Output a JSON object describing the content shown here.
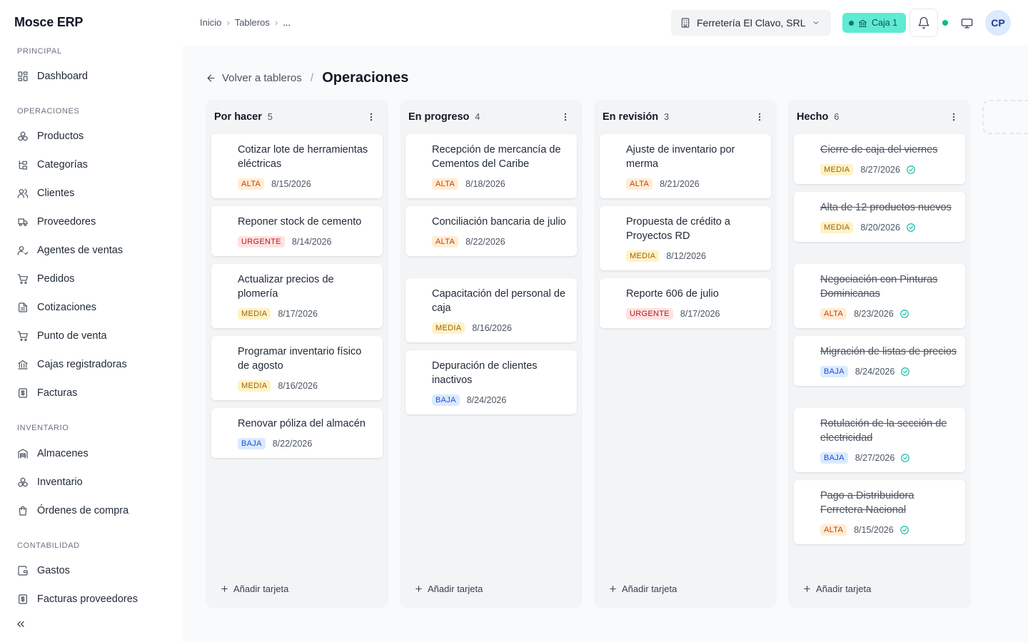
{
  "app": {
    "brand": "Mosce ERP"
  },
  "sidebar": {
    "sections": [
      {
        "label": "PRINCIPAL",
        "items": [
          {
            "label": "Dashboard",
            "icon": "dashboard-icon"
          }
        ]
      },
      {
        "label": "OPERACIONES",
        "items": [
          {
            "label": "Productos",
            "icon": "boxes-icon"
          },
          {
            "label": "Categorías",
            "icon": "tree-icon"
          },
          {
            "label": "Clientes",
            "icon": "users-icon"
          },
          {
            "label": "Proveedores",
            "icon": "truck-icon"
          },
          {
            "label": "Agentes de ventas",
            "icon": "user-check-icon"
          },
          {
            "label": "Pedidos",
            "icon": "cart-icon"
          },
          {
            "label": "Cotizaciones",
            "icon": "file-icon"
          },
          {
            "label": "Punto de venta",
            "icon": "cart-icon"
          },
          {
            "label": "Cajas registradoras",
            "icon": "bank-icon"
          },
          {
            "label": "Facturas",
            "icon": "receipt-icon"
          }
        ]
      },
      {
        "label": "INVENTARIO",
        "items": [
          {
            "label": "Almacenes",
            "icon": "warehouse-icon"
          },
          {
            "label": "Inventario",
            "icon": "boxes-icon"
          },
          {
            "label": "Órdenes de compra",
            "icon": "bag-icon"
          }
        ]
      },
      {
        "label": "CONTABILIDAD",
        "items": [
          {
            "label": "Gastos",
            "icon": "wallet-icon"
          },
          {
            "label": "Facturas proveedores",
            "icon": "receipt-icon"
          }
        ]
      }
    ]
  },
  "header": {
    "breadcrumb": [
      "Inicio",
      "Tableros",
      "..."
    ],
    "company": "Ferretería El Clavo, SRL",
    "caja": "Caja 1",
    "avatar": "CP"
  },
  "main": {
    "back_label": "Volver a tableros",
    "separator": "/",
    "title": "Operaciones",
    "add_card_label": "Añadir tarjeta",
    "columns": [
      {
        "name": "Por hacer",
        "count": "5",
        "cards": [
          {
            "title": "Cotizar lote de herramientas eléctricas",
            "priority": "ALTA",
            "date": "8/15/2026"
          },
          {
            "title": "Reponer stock de cemento",
            "priority": "URGENTE",
            "date": "8/14/2026"
          },
          {
            "title": "Actualizar precios de plomería",
            "priority": "MEDIA",
            "date": "8/17/2026"
          },
          {
            "title": "Programar inventario físico de agosto",
            "priority": "MEDIA",
            "date": "8/16/2026"
          },
          {
            "title": "Renovar póliza del almacén",
            "priority": "BAJA",
            "date": "8/22/2026"
          }
        ]
      },
      {
        "name": "En progreso",
        "count": "4",
        "cards": [
          {
            "title": "Recepción de mercancía de Cementos del Caribe",
            "priority": "ALTA",
            "date": "8/18/2026"
          },
          {
            "title": "Conciliación bancaria de julio",
            "priority": "ALTA",
            "date": "8/22/2026"
          },
          {
            "title": "Capacitación del personal de caja",
            "priority": "MEDIA",
            "date": "8/16/2026"
          },
          {
            "title": "Depuración de clientes inactivos",
            "priority": "BAJA",
            "date": "8/24/2026"
          }
        ]
      },
      {
        "name": "En revisión",
        "count": "3",
        "cards": [
          {
            "title": "Ajuste de inventario por merma",
            "priority": "ALTA",
            "date": "8/21/2026"
          },
          {
            "title": "Propuesta de crédito a Proyectos RD",
            "priority": "MEDIA",
            "date": "8/12/2026"
          },
          {
            "title": "Reporte 606 de julio",
            "priority": "URGENTE",
            "date": "8/17/2026"
          }
        ]
      },
      {
        "name": "Hecho",
        "count": "6",
        "done": true,
        "cards": [
          {
            "title": "Cierre de caja del viernes",
            "priority": "MEDIA",
            "date": "8/27/2026"
          },
          {
            "title": "Alta de 12 productos nuevos",
            "priority": "MEDIA",
            "date": "8/20/2026"
          },
          {
            "title": "Negociación con Pinturas Dominicanas",
            "priority": "ALTA",
            "date": "8/23/2026"
          },
          {
            "title": "Migración de listas de precios",
            "priority": "BAJA",
            "date": "8/24/2026"
          },
          {
            "title": "Rotulación de la sección de electricidad",
            "priority": "BAJA",
            "date": "8/27/2026"
          },
          {
            "title": "Pago a Distribuidora Ferretera Nacional",
            "priority": "ALTA",
            "date": "8/15/2026"
          }
        ]
      }
    ]
  }
}
